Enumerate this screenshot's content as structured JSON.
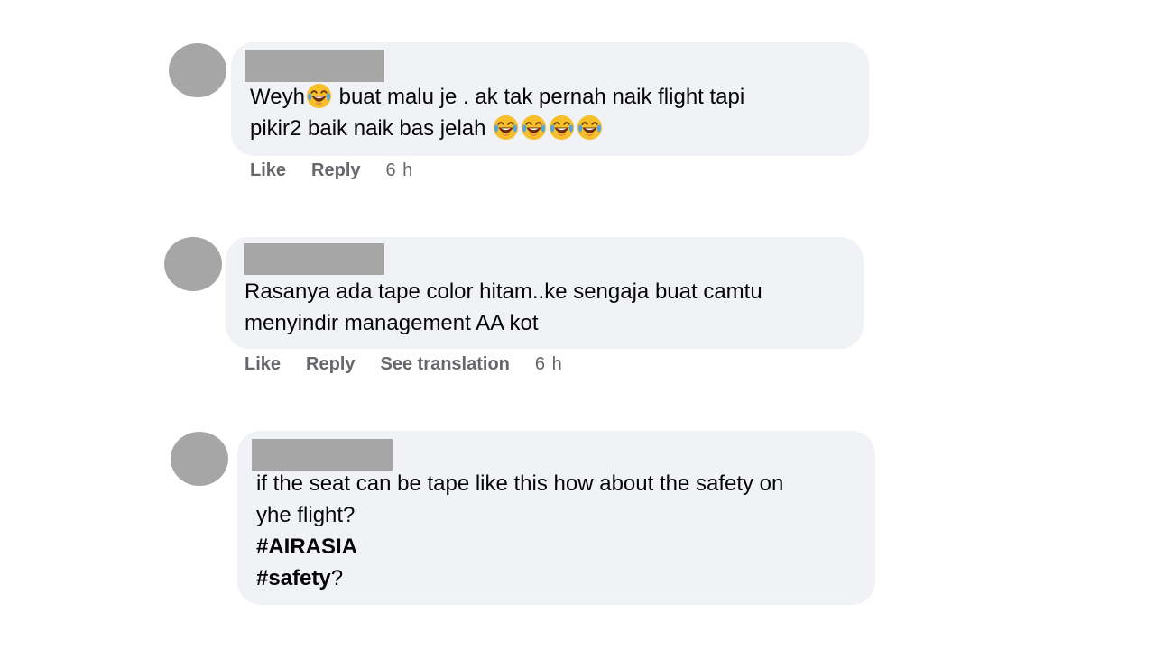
{
  "comments": [
    {
      "line1_pre": "Weyh",
      "line1_post": " buat malu je . ak tak pernah naik flight tapi",
      "line2": "pikir2 baik naik bas jelah ",
      "emoji_icon": "face-with-tears-of-joy",
      "like_label": "Like",
      "reply_label": "Reply",
      "timestamp": "6 h"
    },
    {
      "line1": "Rasanya ada tape color hitam..ke sengaja buat camtu",
      "line2": "menyindir management AA kot",
      "like_label": "Like",
      "reply_label": "Reply",
      "translate_label": "See translation",
      "timestamp": "6 h"
    },
    {
      "line1": "if the seat can be tape like this how about the safety on",
      "line2": "yhe flight?",
      "hashtag1": "#AIRASIA",
      "hashtag2": "#safety",
      "hashtag2_suffix": "?"
    }
  ],
  "colors": {
    "bubble": "#f0f2f5",
    "redaction": "#a6a6a6",
    "action_text": "#65676b",
    "body_text": "#050505"
  }
}
